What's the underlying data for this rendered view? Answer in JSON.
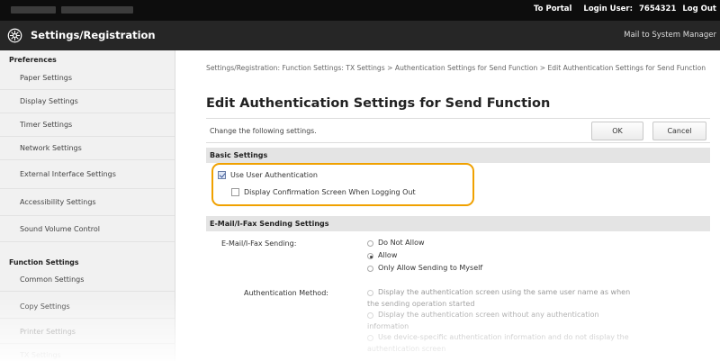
{
  "topbar": {
    "portal_link": "To Portal",
    "login_user": "Login User:",
    "user_id": "7654321",
    "logout": "Log Out"
  },
  "header": {
    "logo_icon": "settings-gear-icon",
    "title": "Settings/Registration",
    "mail_link": "Mail to System Manager"
  },
  "sidebar": {
    "preferences_heading": "Preferences",
    "preferences_items": [
      "Paper Settings",
      "Display Settings",
      "Timer Settings",
      "Network Settings",
      "External Interface Settings",
      "Accessibility Settings",
      "Sound Volume Control"
    ],
    "function_heading": "Function Settings",
    "function_items": [
      "Common Settings",
      "Copy Settings",
      "Printer Settings",
      "TX Settings"
    ]
  },
  "main": {
    "breadcrumb": "Settings/Registration: Function Settings: TX Settings > Authentication Settings for Send Function > Edit Authentication Settings for Send Function",
    "title": "Edit Authentication Settings for Send Function",
    "change_label": "Change the following settings.",
    "ok_label": "OK",
    "cancel_label": "Cancel",
    "basic": {
      "heading": "Basic Settings",
      "use_user_auth": {
        "label": "Use User Authentication",
        "checked": true
      },
      "display_confirm": {
        "label": "Display Confirmation Screen When Logging Out",
        "checked": false
      }
    },
    "email": {
      "heading": "E-Mail/I-Fax Sending Settings",
      "sending_label": "E-Mail/I-Fax Sending:",
      "sending_options": [
        "Do Not Allow",
        "Allow",
        "Only Allow Sending to Myself"
      ],
      "sending_selected": "Allow",
      "auth_label": "Authentication Method:",
      "auth_option_1_line1": "Display the authentication screen using the same user name as when",
      "auth_option_1_line2": "the sending operation started",
      "auth_option_2_line1": "Display the authentication screen without any authentication",
      "auth_option_2_line2": "information",
      "auth_option_3_line1": "Use device-specific authentication information and do not display the",
      "auth_option_3_line2": "authentication screen"
    }
  },
  "colors": {
    "topbar_bg": "#0d0d0d",
    "header_bg": "#262626",
    "highlight": "#f0a100",
    "sidebar_bg": "#f1f1f1"
  }
}
